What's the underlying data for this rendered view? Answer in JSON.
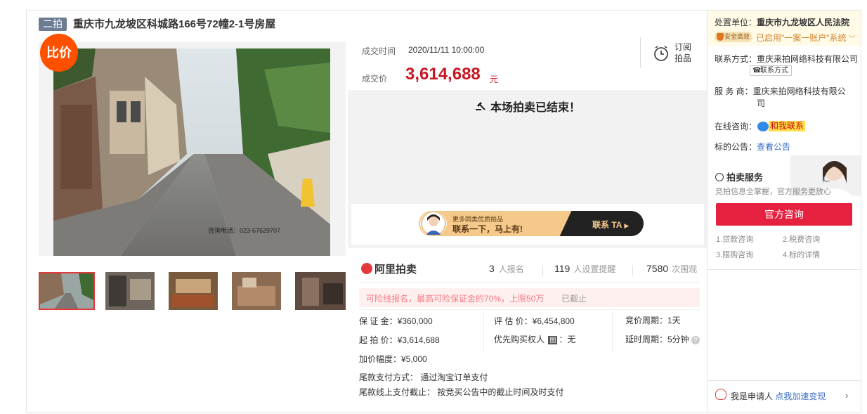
{
  "title": {
    "tag": "二拍",
    "text": "重庆市九龙坡区科城路166号72幢2-1号房屋"
  },
  "gallery": {
    "badge": "比价",
    "watermark_court": "重庆市九龙坡区人民法院",
    "watermark_phone": "咨询电话：023-67629707",
    "thumbnails": 5,
    "active_thumbnail": 1
  },
  "deal": {
    "time_label": "成交时间",
    "time_value": "2020/11/11 10:00:00",
    "price_label": "成交价",
    "price_value": "3,614,688",
    "price_unit": "元",
    "subscribe_label": "订阅拍品"
  },
  "status": {
    "ended": "本场拍卖已结束！",
    "gavel_icon": "gavel-icon"
  },
  "banner": {
    "line1": "更多同类优质拍品",
    "line2": "联系一下，马上有!",
    "cta": "联系 TA"
  },
  "platform": {
    "logo": "阿里拍卖",
    "stats": [
      {
        "num": "3",
        "label": "人报名"
      },
      {
        "num": "119",
        "label": "人设置提醒"
      },
      {
        "num": "7580",
        "label": "次围观"
      }
    ]
  },
  "notice": {
    "text": "可险线报名，最高可险保证金的70%，上限50万",
    "state": "已截止"
  },
  "info": {
    "deposit": "保 证 金：¥360,000",
    "appraisal": "评 估 价：¥6,454,800",
    "cycle": "竞价周期：1天",
    "start_price": "起 拍 价：¥3,614,688",
    "priority_buyer_label": "优先购买权人",
    "priority_buyer_badge": "图",
    "priority_buyer_value": "：无",
    "delay": "延时周期：5分钟",
    "increment": "加价幅度：¥5,000",
    "final_payment_method": "尾款支付方式：  通过淘宝订单支付",
    "final_payment_deadline": "尾款线上支付截止：  按竞买公告中的截止时间及时支付"
  },
  "sidebar": {
    "unit_label": "处置单位：",
    "unit_value": "重庆市九龙坡区人民法院",
    "badge": "安全高效",
    "enabled_text": "已启用\"一案一账户\"系统",
    "contact_label": "联系方式：",
    "contact_value": "重庆来拍网络科技有限公司",
    "contact_button": "联系方式",
    "provider_label": "服 务 商：",
    "provider_value_1": "重庆来拍网络科技有限公",
    "provider_value_2": "司",
    "online_label": "在线咨询：",
    "online_tag": "和我联系",
    "announce_label": "标的公告：",
    "announce_link": "查看公告",
    "service_title": "拍卖服务",
    "service_sub": "竞拍信息全掌握，官方服务更放心",
    "official_button": "官方咨询",
    "links": [
      "1.贷款咨询",
      "2.税费咨询",
      "3.限购咨询",
      "4.标的详情"
    ],
    "applicant_text": "我是申请人",
    "applicant_link": "点我加速变现"
  },
  "colors": {
    "accent": "#c81623",
    "official": "#e6203f",
    "orange": "#ff5000",
    "link": "#3a6fc7"
  }
}
